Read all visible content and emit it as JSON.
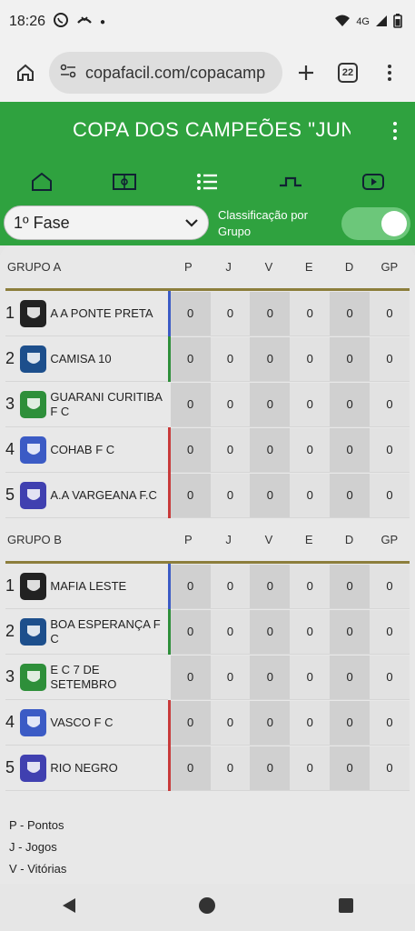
{
  "status": {
    "time": "18:26",
    "network": "4G"
  },
  "browser": {
    "url": "copafacil.com/copacamp",
    "tab_count": "22"
  },
  "app": {
    "title": "COPA DOS CAMPEÕES \"JUN"
  },
  "nav": {
    "items": [
      "home-icon",
      "field-icon",
      "list-icon",
      "bracket-icon",
      "video-icon"
    ],
    "selected": "list-icon"
  },
  "filters": {
    "phase": "1º Fase",
    "toggle_label": "Classificação por Grupo",
    "toggle_on": true
  },
  "columns": [
    "P",
    "J",
    "V",
    "E",
    "D",
    "GP"
  ],
  "groups": [
    {
      "name": "GRUPO A",
      "rows": [
        {
          "pos": "1",
          "team": "A A PONTE PRETA",
          "indicator": "#3b5bc5",
          "values": [
            "0",
            "0",
            "0",
            "0",
            "0",
            "0"
          ]
        },
        {
          "pos": "2",
          "team": "CAMISA 10",
          "indicator": "#2e8f3a",
          "values": [
            "0",
            "0",
            "0",
            "0",
            "0",
            "0"
          ]
        },
        {
          "pos": "3",
          "team": "GUARANI CURITIBA F C",
          "indicator": "#e8e8e8",
          "values": [
            "0",
            "0",
            "0",
            "0",
            "0",
            "0"
          ]
        },
        {
          "pos": "4",
          "team": "COHAB F C",
          "indicator": "#c83a3a",
          "values": [
            "0",
            "0",
            "0",
            "0",
            "0",
            "0"
          ]
        },
        {
          "pos": "5",
          "team": "A.A VARGEANA F.C",
          "indicator": "#c83a3a",
          "values": [
            "0",
            "0",
            "0",
            "0",
            "0",
            "0"
          ]
        }
      ]
    },
    {
      "name": "GRUPO B",
      "rows": [
        {
          "pos": "1",
          "team": "MAFIA LESTE",
          "indicator": "#3b5bc5",
          "values": [
            "0",
            "0",
            "0",
            "0",
            "0",
            "0"
          ]
        },
        {
          "pos": "2",
          "team": "BOA ESPERANÇA F C",
          "indicator": "#2e8f3a",
          "values": [
            "0",
            "0",
            "0",
            "0",
            "0",
            "0"
          ]
        },
        {
          "pos": "3",
          "team": "E C 7 DE SETEMBRO",
          "indicator": "#e8e8e8",
          "values": [
            "0",
            "0",
            "0",
            "0",
            "0",
            "0"
          ]
        },
        {
          "pos": "4",
          "team": "VASCO F C",
          "indicator": "#c83a3a",
          "values": [
            "0",
            "0",
            "0",
            "0",
            "0",
            "0"
          ]
        },
        {
          "pos": "5",
          "team": "RIO NEGRO",
          "indicator": "#c83a3a",
          "values": [
            "0",
            "0",
            "0",
            "0",
            "0",
            "0"
          ]
        }
      ]
    }
  ],
  "legend": [
    "P - Pontos",
    "J - Jogos",
    "V - Vitórias"
  ],
  "colors": {
    "app_green": "#2fa23f",
    "divider_gold": "#8c7e3c"
  }
}
